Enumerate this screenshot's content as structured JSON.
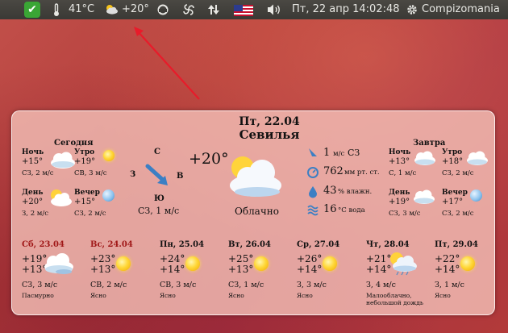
{
  "panel": {
    "temp": "41°C",
    "weather": "+20°",
    "datetime": "Пт, 22 апр 14:02:48",
    "user": "Compizomania"
  },
  "colors": {
    "accent_check": "#3aa635",
    "wind_arrow": "#3b7fc4",
    "arrow_red": "#e81b2a"
  },
  "widget": {
    "date": "Пт, 22.04",
    "city": "Севилья",
    "today": {
      "title": "Сегодня",
      "night": {
        "label": "Ночь",
        "temp": "+15°",
        "wind": "СЗ, 2 м/с"
      },
      "morning": {
        "label": "Утро",
        "temp": "+19°",
        "wind": "СВ, 3 м/с"
      },
      "day": {
        "label": "День",
        "temp": "+20°",
        "wind": "З, 2 м/с"
      },
      "evening": {
        "label": "Вечер",
        "temp": "+15°",
        "wind": "СЗ, 2 м/с"
      }
    },
    "compass": {
      "n": "С",
      "s": "Ю",
      "w": "З",
      "e": "В",
      "wind": "СЗ, 1 м/с"
    },
    "current": {
      "temp": "+20°",
      "condition": "Облачно"
    },
    "stats": {
      "wind_val": "1",
      "wind_unit": "м/с",
      "wind_dir": "СЗ",
      "pressure_val": "762",
      "pressure_unit": "мм рт. ст.",
      "humidity_val": "43",
      "humidity_unit": "% влажн.",
      "water_val": "16",
      "water_unit": "°С вода"
    },
    "tomorrow": {
      "title": "Завтра",
      "night": {
        "label": "Ночь",
        "temp": "+13°",
        "wind": "С, 1 м/с"
      },
      "morning": {
        "label": "Утро",
        "temp": "+18°",
        "wind": "СЗ, 2 м/с"
      },
      "day": {
        "label": "День",
        "temp": "+19°",
        "wind": "СЗ, 3 м/с"
      },
      "evening": {
        "label": "Вечер",
        "temp": "+17°",
        "wind": "СЗ, 2 м/с"
      }
    },
    "forecast": [
      {
        "day": "Сб, 23.04",
        "hi": "+19°",
        "lo": "+13°",
        "wind": "СЗ, 3 м/с",
        "cond": "Пасмурно",
        "cond2": "",
        "icon": "overcast-icon",
        "weekend": true
      },
      {
        "day": "Вс, 24.04",
        "hi": "+23°",
        "lo": "+13°",
        "wind": "СВ, 2 м/с",
        "cond": "Ясно",
        "cond2": "",
        "icon": "sun-icon",
        "weekend": true
      },
      {
        "day": "Пн, 25.04",
        "hi": "+24°",
        "lo": "+14°",
        "wind": "СВ, 3 м/с",
        "cond": "Ясно",
        "cond2": "",
        "icon": "sun-icon",
        "weekend": false
      },
      {
        "day": "Вт, 26.04",
        "hi": "+25°",
        "lo": "+13°",
        "wind": "СЗ, 1 м/с",
        "cond": "Ясно",
        "cond2": "",
        "icon": "sun-icon",
        "weekend": false
      },
      {
        "day": "Ср, 27.04",
        "hi": "+26°",
        "lo": "+14°",
        "wind": "З, 3 м/с",
        "cond": "Ясно",
        "cond2": "",
        "icon": "sun-icon",
        "weekend": false
      },
      {
        "day": "Чт, 28.04",
        "hi": "+21°",
        "lo": "+14°",
        "wind": "З, 4 м/с",
        "cond": "Малооблачно,",
        "cond2": "небольшой дождь",
        "icon": "rain-cloud-icon",
        "weekend": false
      },
      {
        "day": "Пт, 29.04",
        "hi": "+22°",
        "lo": "+14°",
        "wind": "З, 1 м/с",
        "cond": "Ясно",
        "cond2": "",
        "icon": "sun-icon",
        "weekend": false
      }
    ]
  }
}
